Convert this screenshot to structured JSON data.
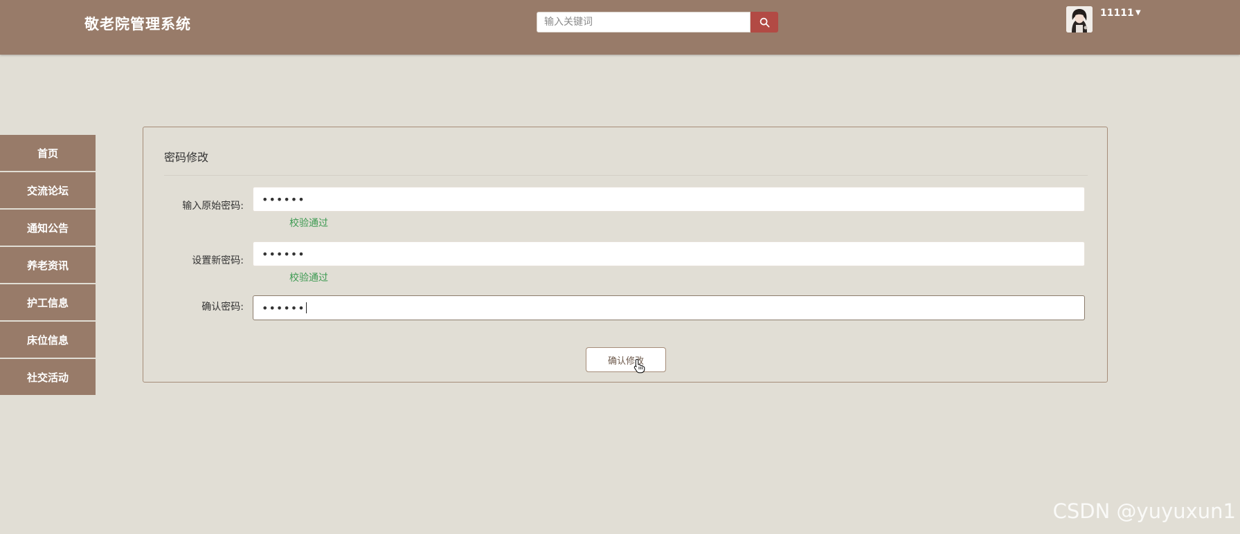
{
  "header": {
    "brand": "敬老院管理系统",
    "search_placeholder": "输入关键词",
    "username": "11111",
    "search_icon": "search-icon",
    "caret_icon": "caret-down-icon"
  },
  "sidebar": {
    "items": [
      {
        "label": "首页"
      },
      {
        "label": "交流论坛"
      },
      {
        "label": "通知公告"
      },
      {
        "label": "养老资讯"
      },
      {
        "label": "护工信息"
      },
      {
        "label": "床位信息"
      },
      {
        "label": "社交活动"
      }
    ]
  },
  "form": {
    "title": "密码修改",
    "fields": [
      {
        "label": "输入原始密码:",
        "value": "••••••",
        "hint": "校验通过"
      },
      {
        "label": "设置新密码:",
        "value": "••••••",
        "hint": "校验通过"
      },
      {
        "label": "确认密码:",
        "value": "••••••"
      }
    ],
    "submit_label": "确认修改"
  },
  "watermark": "CSDN @yuyuxun1",
  "colors": {
    "header_bg": "#987b69",
    "page_bg": "#e1ded5",
    "search_button": "#b24a44",
    "hint_green": "#3d9a52"
  }
}
